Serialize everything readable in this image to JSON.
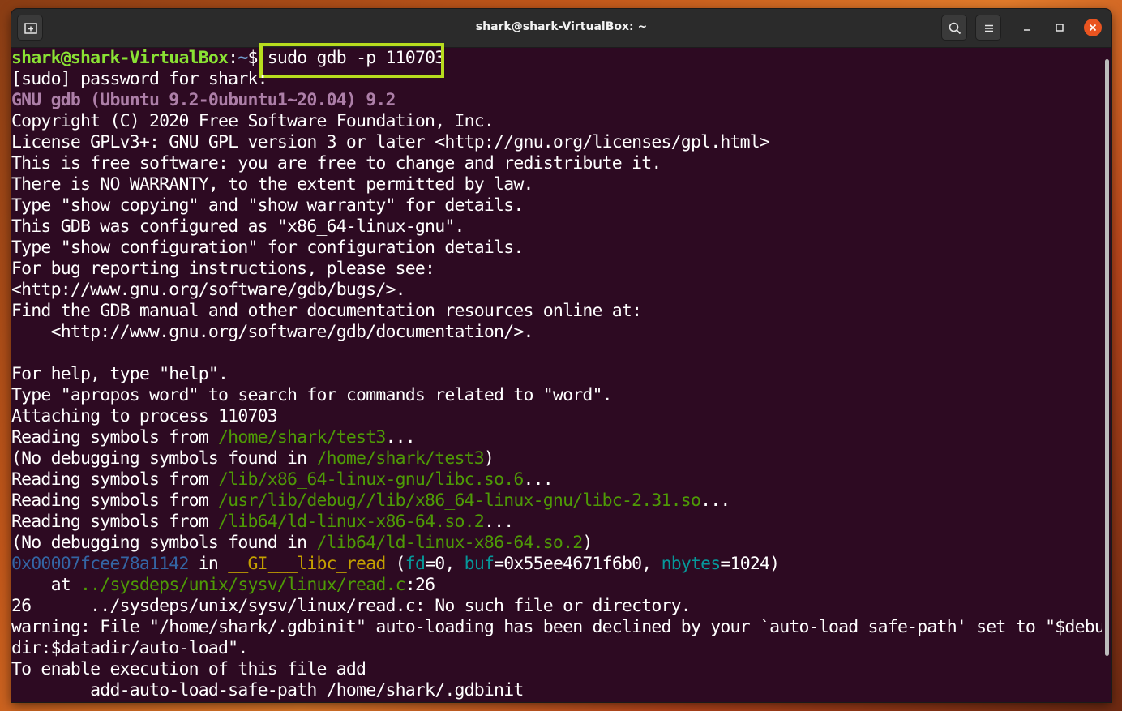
{
  "window": {
    "title": "shark@shark-VirtualBox: ~"
  },
  "icons": {
    "new_tab": "new-tab-icon",
    "search": "search-icon",
    "menu": "hamburger-menu-icon",
    "minimize": "minimize-icon",
    "maximize": "maximize-icon",
    "close": "close-icon"
  },
  "colors": {
    "terminal_bg": "#2d0a22",
    "highlight": "#b7dc1e",
    "close_button": "#e95420"
  },
  "terminal": {
    "prompt_user": "shark@shark-VirtualBox",
    "prompt_colon": ":",
    "prompt_path": "~",
    "prompt_dollar": "$ ",
    "command": "sudo gdb -p 110703",
    "l1": "[sudo] password for shark:",
    "l2": "GNU gdb (Ubuntu 9.2-0ubuntu1~20.04) 9.2",
    "l3": "Copyright (C) 2020 Free Software Foundation, Inc.",
    "l4": "License GPLv3+: GNU GPL version 3 or later <http://gnu.org/licenses/gpl.html>",
    "l5": "This is free software: you are free to change and redistribute it.",
    "l6": "There is NO WARRANTY, to the extent permitted by law.",
    "l7": "Type \"show copying\" and \"show warranty\" for details.",
    "l8": "This GDB was configured as \"x86_64-linux-gnu\".",
    "l9": "Type \"show configuration\" for configuration details.",
    "l10": "For bug reporting instructions, please see:",
    "l11": "<http://www.gnu.org/software/gdb/bugs/>.",
    "l12": "Find the GDB manual and other documentation resources online at:",
    "l13": "    <http://www.gnu.org/software/gdb/documentation/>.",
    "l14": "For help, type \"help\".",
    "l15": "Type \"apropos word\" to search for commands related to \"word\".",
    "l16": "Attaching to process 110703",
    "rs": "Reading symbols from ",
    "nd": "(No debugging symbols found in ",
    "path_test3": "/home/shark/test3",
    "path_libc": "/lib/x86_64-linux-gnu/libc.so.6",
    "path_libc_debug": "/usr/lib/debug//lib/x86_64-linux-gnu/libc-2.31.so",
    "path_ld": "/lib64/ld-linux-x86-64.so.2",
    "ellipsis": "...",
    "close_paren": ")",
    "frame_addr": "0x00007fcee78a1142",
    "frame_in": " in ",
    "frame_func": "__GI___libc_read",
    "frame_open": " (",
    "arg_fd": "fd",
    "arg_fd_val": "=0, ",
    "arg_buf": "buf",
    "arg_buf_val": "=0x55ee4671f6b0, ",
    "arg_nbytes": "nbytes",
    "arg_nbytes_val": "=1024)",
    "at_prefix": "    at ",
    "src_path": "../sysdeps/unix/sysv/linux/read.c",
    "src_line": ":26",
    "l24": "26      ../sysdeps/unix/sysv/linux/read.c: No such file or directory.",
    "l25": "warning: File \"/home/shark/.gdbinit\" auto-loading has been declined by your `auto-load safe-path' set to \"$debug",
    "l26": "dir:$datadir/auto-load\".",
    "l27": "To enable execution of this file add",
    "l28": "        add-auto-load-safe-path /home/shark/.gdbinit"
  }
}
